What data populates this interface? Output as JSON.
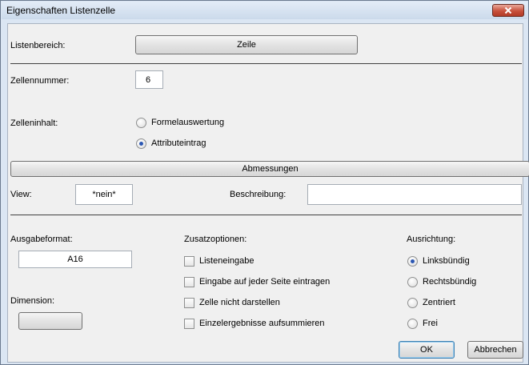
{
  "window": {
    "title": "Eigenschaften Listenzelle"
  },
  "listenbereich": {
    "label": "Listenbereich:",
    "value": "Zeile"
  },
  "zellennummer": {
    "label": "Zellennummer:",
    "value": "6"
  },
  "zelleninhalt": {
    "label": "Zelleninhalt:",
    "options": [
      "Formelauswertung",
      "Attributeintrag"
    ],
    "selected": "Attributeintrag"
  },
  "abmessungen": {
    "label": "Abmessungen"
  },
  "view": {
    "label": "View:",
    "value": "*nein*"
  },
  "beschreibung": {
    "label": "Beschreibung:",
    "value": ""
  },
  "ausgabeformat": {
    "label": "Ausgabeformat:",
    "value": "A16"
  },
  "dimension": {
    "label": "Dimension:",
    "button_label": ""
  },
  "zusatzoptionen": {
    "label": "Zusatzoptionen:",
    "items": [
      {
        "label": "Listeneingabe",
        "checked": false
      },
      {
        "label": "Eingabe auf jeder Seite eintragen",
        "checked": false
      },
      {
        "label": "Zelle nicht darstellen",
        "checked": false
      },
      {
        "label": "Einzelergebnisse aufsummieren",
        "checked": false
      }
    ]
  },
  "ausrichtung": {
    "label": "Ausrichtung:",
    "options": [
      "Linksbündig",
      "Rechtsbündig",
      "Zentriert",
      "Frei"
    ],
    "selected": "Linksbündig"
  },
  "buttons": {
    "ok": "OK",
    "cancel": "Abbrechen"
  },
  "colors": {
    "radio_dot": "#2b57b3",
    "close_button": "#c8513c"
  },
  "icons": {
    "close": "close-icon"
  }
}
